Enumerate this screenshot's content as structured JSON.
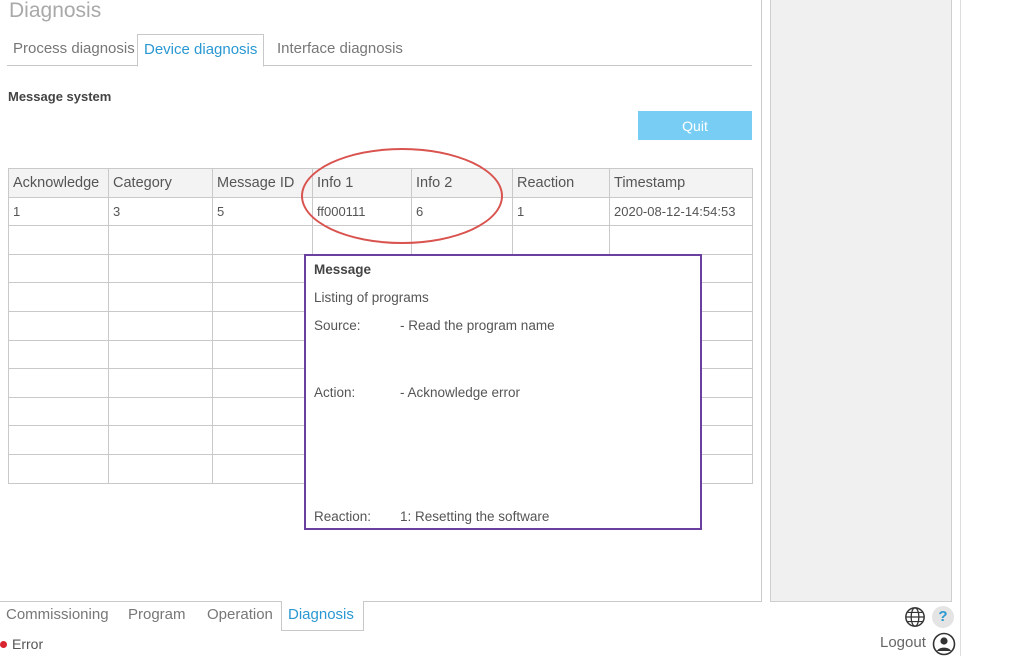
{
  "page": {
    "title": "Diagnosis"
  },
  "tabs": [
    {
      "label": "Process diagnosis"
    },
    {
      "label": "Device diagnosis"
    },
    {
      "label": "Interface diagnosis"
    }
  ],
  "section": {
    "title": "Message system"
  },
  "quit_label": "Quit",
  "table": {
    "headers": [
      "Acknowledge",
      "Category",
      "Message ID",
      "Info 1",
      "Info 2",
      "Reaction",
      "Timestamp"
    ],
    "rows": [
      [
        "1",
        "3",
        "5",
        "ff000111",
        "6",
        "1",
        "2020-08-12-14:54:53"
      ]
    ]
  },
  "popup": {
    "title": "Message",
    "line1": "Listing of programs",
    "source_label": "Source:",
    "source_value": "- Read the program name",
    "action_label": "Action:",
    "action_value": "- Acknowledge error",
    "reaction_label": "Reaction:",
    "reaction_value": "1: Resetting the software"
  },
  "bottom_tabs": [
    {
      "label": "Commissioning"
    },
    {
      "label": "Program"
    },
    {
      "label": "Operation"
    },
    {
      "label": "Diagnosis"
    }
  ],
  "status": {
    "text": "Error"
  },
  "logout_label": "Logout",
  "help_glyph": "?",
  "colors": {
    "accent": "#2a98d2",
    "quit_button": "#78cdf5",
    "error_dot": "#d9232f",
    "popup_border": "#6b3fa0",
    "annotation_ellipse": "#d9534f"
  }
}
